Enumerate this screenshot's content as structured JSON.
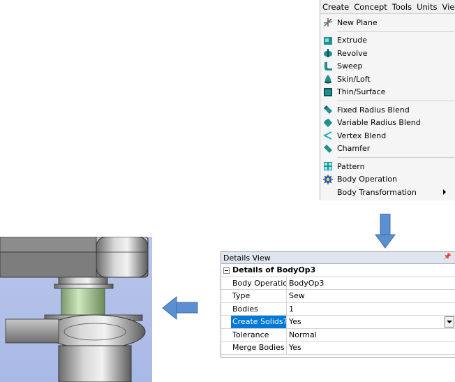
{
  "menubar": {
    "items": [
      "Create",
      "Concept",
      "Tools",
      "Units",
      "Vie"
    ]
  },
  "create_menu": {
    "groups": [
      {
        "items": [
          {
            "label": "New Plane",
            "icon": "new-plane-icon"
          }
        ]
      },
      {
        "items": [
          {
            "label": "Extrude",
            "icon": "extrude-icon"
          },
          {
            "label": "Revolve",
            "icon": "revolve-icon"
          },
          {
            "label": "Sweep",
            "icon": "sweep-icon"
          },
          {
            "label": "Skin/Loft",
            "icon": "skin-loft-icon"
          },
          {
            "label": "Thin/Surface",
            "icon": "thin-surface-icon"
          }
        ]
      },
      {
        "items": [
          {
            "label": "Fixed Radius Blend",
            "icon": "fixed-radius-blend-icon"
          },
          {
            "label": "Variable Radius Blend",
            "icon": "variable-radius-blend-icon"
          },
          {
            "label": "Vertex Blend",
            "icon": "vertex-blend-icon"
          },
          {
            "label": "Chamfer",
            "icon": "chamfer-icon"
          }
        ]
      },
      {
        "items": [
          {
            "label": "Pattern",
            "icon": "pattern-icon"
          },
          {
            "label": "Body Operation",
            "icon": "body-operation-icon"
          },
          {
            "label": "Body Transformation",
            "icon": "",
            "submenu": true
          }
        ]
      }
    ]
  },
  "details_view": {
    "title": "Details View",
    "pin_icon": "pin-icon",
    "group_title": "Details of BodyOp3",
    "rows": [
      {
        "key": "Body Operation",
        "value": "BodyOp3"
      },
      {
        "key": "Type",
        "value": "Sew"
      },
      {
        "key": "Bodies",
        "value": "1"
      },
      {
        "key": "Create Solids?",
        "value": "Yes",
        "selected": true,
        "dropdown": true
      },
      {
        "key": "Tolerance",
        "value": "Normal"
      },
      {
        "key": "Merge Bodies",
        "value": "Yes"
      }
    ]
  },
  "colors": {
    "arrow": "#4f81bd",
    "selection": "#0078d7",
    "viewport_bg": "#b9c6ea"
  }
}
